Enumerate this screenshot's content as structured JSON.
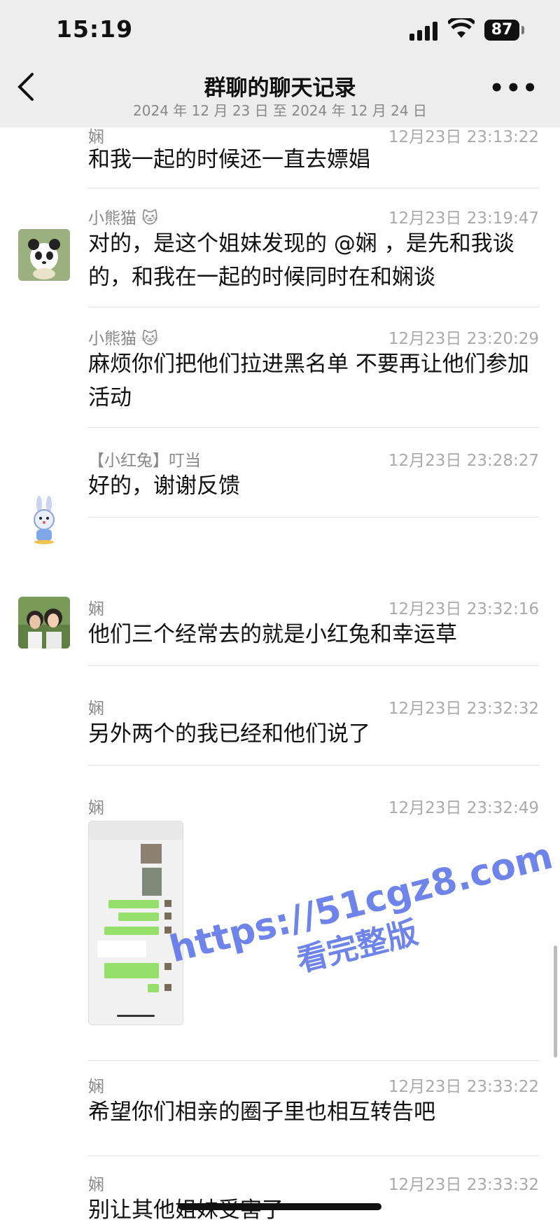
{
  "status": {
    "time": "15:19",
    "battery": "87"
  },
  "nav": {
    "back_icon": "chevron-left",
    "title": "群聊的聊天记录",
    "subtitle": "2024 年 12 月 23 日 至 2024 年 12 月 24 日",
    "more_icon": "ellipsis"
  },
  "messages": [
    {
      "sender": "娴",
      "time": "12月23日 23:13:22",
      "text": "和我一起的时候还一直去嫖娼"
    },
    {
      "sender": "小熊猫 🐱",
      "time": "12月23日 23:19:47",
      "text": "对的，是这个姐妹发现的 @娴 ，是先和我谈的，和我在一起的时候同时在和娴谈",
      "avatar": "panda-avatar"
    },
    {
      "sender": "小熊猫 🐱",
      "time": "12月23日 23:20:29",
      "text": "麻烦你们把他们拉进黑名单 不要再让他们参加活动"
    },
    {
      "sender": "【小红兔】叮当",
      "time": "12月23日 23:28:27",
      "text": "好的，谢谢反馈",
      "avatar": "rabbit-avatar"
    },
    {
      "sender": "娴",
      "time": "12月23日 23:32:16",
      "text": "他们三个经常去的就是小红兔和幸运草",
      "avatar": "photo-avatar"
    },
    {
      "sender": "娴",
      "time": "12月23日 23:32:32",
      "text": "另外两个的我已经和他们说了"
    },
    {
      "sender": "娴",
      "time": "12月23日 23:32:49",
      "image": "chat-screenshot-thumbnail"
    },
    {
      "sender": "娴",
      "time": "12月23日 23:33:22",
      "text": "希望你们相亲的圈子里也相互转告吧"
    },
    {
      "sender": "娴",
      "time": "12月23日 23:33:32",
      "text": "别让其他姐妹受害了"
    }
  ],
  "watermark": {
    "line1": "https://51cgz8.com",
    "line2": "看完整版"
  }
}
